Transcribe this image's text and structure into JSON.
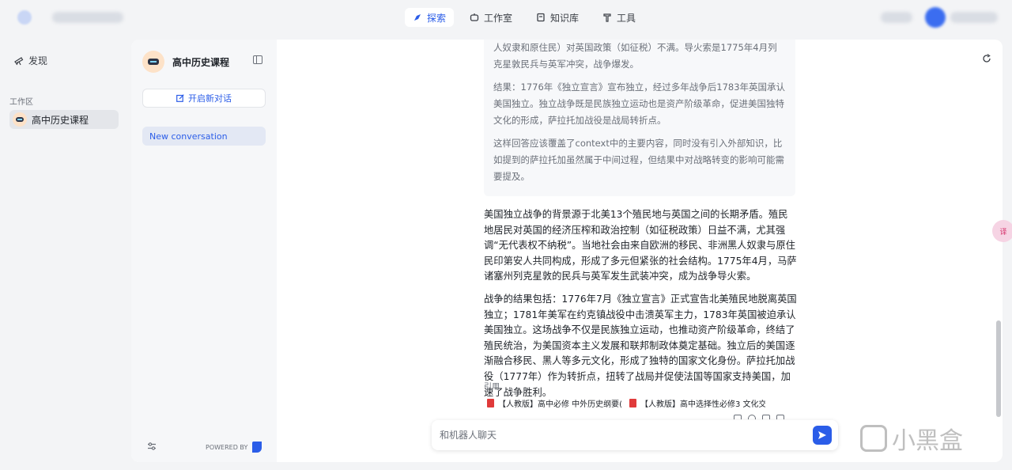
{
  "header": {
    "tabs": [
      {
        "label": "探索",
        "icon": "compass-icon",
        "active": true
      },
      {
        "label": "工作室",
        "icon": "robot-icon",
        "active": false
      },
      {
        "label": "知识库",
        "icon": "book-icon",
        "active": false
      },
      {
        "label": "工具",
        "icon": "tool-icon",
        "active": false
      }
    ]
  },
  "left_nav": {
    "discover_label": "发现",
    "workspace_label": "工作区",
    "workspace_item": "高中历史课程"
  },
  "sidebar": {
    "title": "高中历史课程",
    "new_chat_label": "开启新对话",
    "conversations": [
      "New conversation"
    ],
    "powered_by": "POWERED BY"
  },
  "chat": {
    "thinking": [
      "人奴隶和原住民）对英国政策（如征税）不满。导火索是1775年4月列克星敦民兵与英军冲突，战争爆发。",
      "结果：1776年《独立宣言》宣布独立，经过多年战争后1783年英国承认美国独立。独立战争既是民族独立运动也是资产阶级革命，促进美国独特文化的形成，萨拉托加战役是战局转折点。",
      "这样回答应该覆盖了context中的主要内容，同时没有引入外部知识，比如提到的萨拉托加虽然属于中间过程，但结果中对战略转变的影响可能需要提及。"
    ],
    "answer": [
      "美国独立战争的背景源于北美13个殖民地与英国之间的长期矛盾。殖民地居民对英国的经济压榨和政治控制（如征税政策）日益不满，尤其强调“无代表权不纳税”。当地社会由来自欧洲的移民、非洲黑人奴隶与原住民印第安人共同构成，形成了多元但紧张的社会结构。1775年4月，马萨诸塞州列克星敦的民兵与英军发生武装冲突，成为战争导火索。",
      "战争的结果包括：1776年7月《独立宣言》正式宣告北美殖民地脱离英国独立；1781年美军在约克镇战役中击溃英军主力，1783年英国被迫承认美国独立。这场战争不仅是民族独立运动，也推动资产阶级革命，终结了殖民统治，为美国资本主义发展和联邦制政体奠定基础。独立后的美国逐渐融合移民、黑人等多元文化，形成了独特的国家文化身份。萨拉托加战役（1777年）作为转折点，扭转了战局并促使法国等国家支持美国，加速了战争胜利。"
    ],
    "citation_label": "引用",
    "citations": [
      "【人教版】高中必修 中外历史纲要(...",
      "【人教版】高中选择性必修3 文化交..."
    ],
    "input_placeholder": "和机器人聊天"
  },
  "floating_button_label": "译",
  "watermark": "小黑盒",
  "colors": {
    "accent": "#2b5de8",
    "pdf": "#e03a3a"
  }
}
